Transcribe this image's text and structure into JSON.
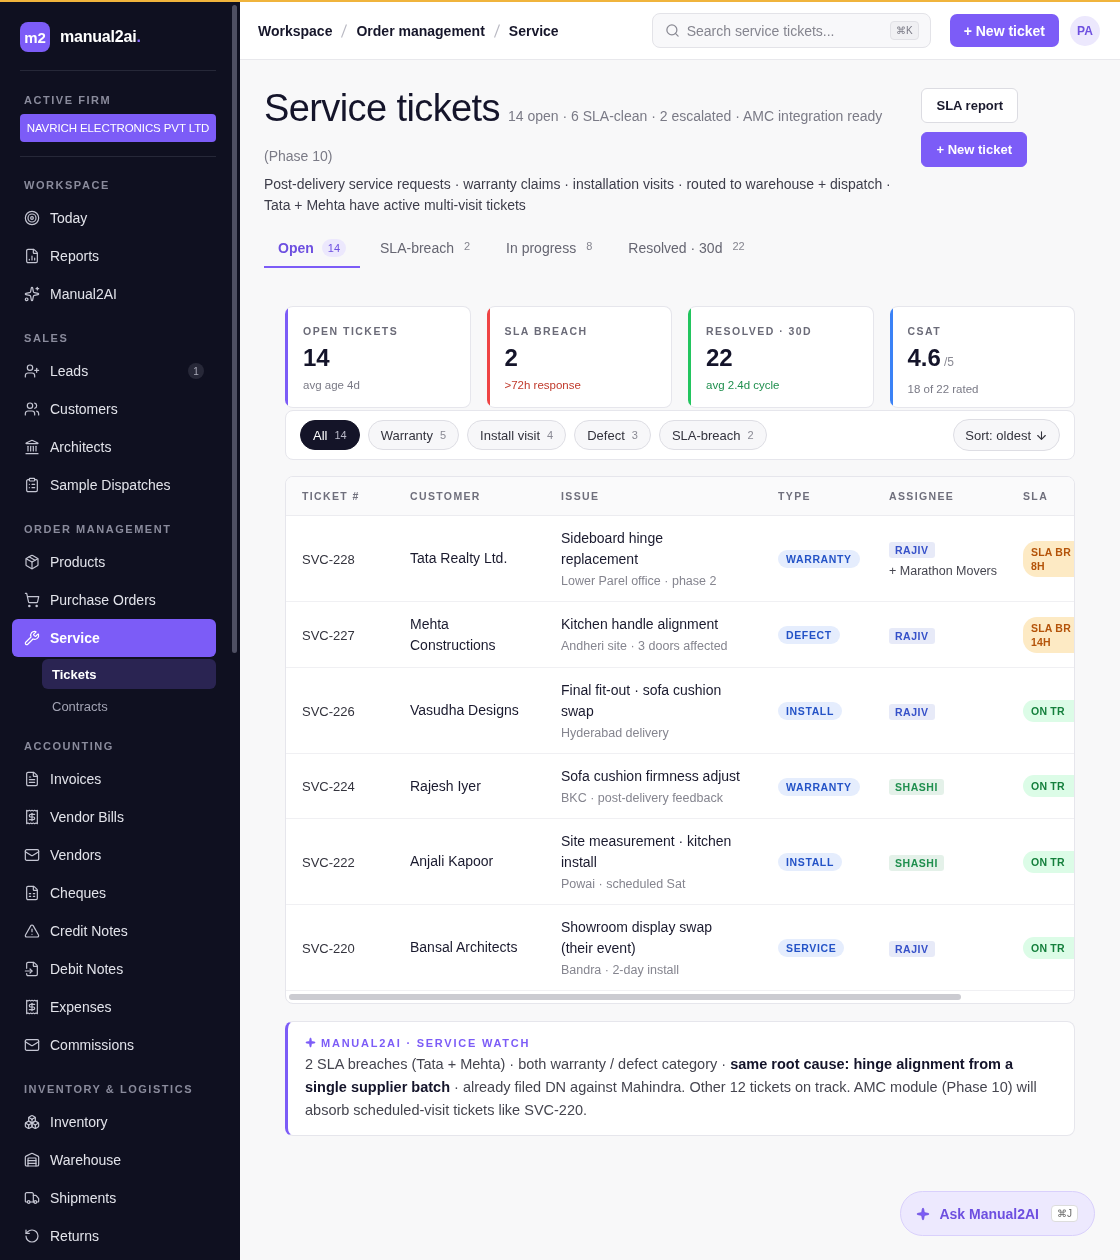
{
  "sidebar": {
    "brand": {
      "logo": "m2",
      "name": "manual2ai",
      "dot": "."
    },
    "active_firm": {
      "label": "ACTIVE FIRM",
      "value": "NAVRICH ELECTRONICS PVT LTD"
    },
    "sections": [
      {
        "title": "WORKSPACE",
        "items": [
          {
            "label": "Today",
            "selected": false
          },
          {
            "label": "Reports",
            "selected": false
          },
          {
            "label": "Manual2AI",
            "selected": false
          }
        ]
      },
      {
        "title": "SALES",
        "items": [
          {
            "label": "Leads",
            "badge": "1",
            "selected": false
          },
          {
            "label": "Customers",
            "selected": false
          },
          {
            "label": "Architects",
            "selected": false
          },
          {
            "label": "Sample Dispatches",
            "selected": false
          }
        ]
      },
      {
        "title": "ORDER MANAGEMENT",
        "items": [
          {
            "label": "Products",
            "selected": false
          },
          {
            "label": "Purchase Orders",
            "selected": false
          },
          {
            "label": "Service",
            "selected": true,
            "children": [
              {
                "label": "Tickets",
                "selected": true
              },
              {
                "label": "Contracts",
                "selected": false
              }
            ]
          }
        ]
      },
      {
        "title": "ACCOUNTING",
        "items": [
          {
            "label": "Invoices",
            "selected": false
          },
          {
            "label": "Vendor Bills",
            "selected": false
          },
          {
            "label": "Vendors",
            "selected": false
          },
          {
            "label": "Cheques",
            "selected": false
          },
          {
            "label": "Credit Notes",
            "selected": false
          },
          {
            "label": "Debit Notes",
            "selected": false
          },
          {
            "label": "Expenses",
            "selected": false
          },
          {
            "label": "Commissions",
            "selected": false
          }
        ]
      },
      {
        "title": "INVENTORY & LOGISTICS",
        "items": [
          {
            "label": "Inventory",
            "selected": false
          },
          {
            "label": "Warehouse",
            "selected": false
          },
          {
            "label": "Shipments",
            "selected": false
          },
          {
            "label": "Returns",
            "selected": false
          }
        ]
      }
    ]
  },
  "header": {
    "breadcrumbs": [
      "Workspace",
      "Order management",
      "Service"
    ],
    "search": {
      "placeholder": "Search service tickets...",
      "shortcut": "⌘K"
    },
    "new_button": "+ New ticket",
    "avatar": "PA"
  },
  "page": {
    "title": "Service tickets",
    "subtitle": "14 open · 6 SLA-clean · 2 escalated · AMC integration ready (Phase 10)",
    "description": "Post-delivery service requests · warranty claims · installation visits · routed to warehouse + dispatch · Tata + Mehta have active multi-visit tickets",
    "actions": [
      {
        "label": "SLA report",
        "kind": "secondary"
      },
      {
        "label": "+ New ticket",
        "kind": "primary"
      }
    ]
  },
  "tabs": [
    {
      "label": "Open",
      "count": "14",
      "selected": true
    },
    {
      "label": "SLA-breach",
      "count": "2",
      "selected": false
    },
    {
      "label": "In progress",
      "count": "8",
      "selected": false
    },
    {
      "label": "Resolved · 30d",
      "count": "22",
      "selected": false
    }
  ],
  "stats": [
    {
      "label": "OPEN TICKETS",
      "value": "14",
      "note": {
        "text": "avg age 4d",
        "color": "#7a7a86"
      },
      "color": "#7c5cf7"
    },
    {
      "label": "SLA BREACH",
      "value": "2",
      "note": {
        "text": ">72h response",
        "color": "#c0392b"
      },
      "color": "#ef4444"
    },
    {
      "label": "RESOLVED · 30D",
      "value": "22",
      "note": {
        "text": "avg 2.4d cycle",
        "color": "#1f8f4e"
      },
      "color": "#22c55e"
    },
    {
      "label": "CSAT",
      "value": "4.6",
      "unit": "/5",
      "note": {
        "text": "18 of 22 rated",
        "color": "#7a7a86"
      },
      "color": "#3b82f6"
    }
  ],
  "filters": {
    "chips": [
      {
        "label": "All",
        "count": "14",
        "selected": true
      },
      {
        "label": "Warranty",
        "count": "5",
        "selected": false
      },
      {
        "label": "Install visit",
        "count": "4",
        "selected": false
      },
      {
        "label": "Defect",
        "count": "3",
        "selected": false
      },
      {
        "label": "SLA-breach",
        "count": "2",
        "selected": false
      }
    ],
    "sort": "Sort: oldest"
  },
  "table": {
    "columns": [
      "TICKET #",
      "CUSTOMER",
      "ISSUE",
      "TYPE",
      "ASSIGNEE",
      "SLA"
    ],
    "rows": [
      {
        "ticket": "SVC-228",
        "customer": "Tata Realty Ltd.",
        "issue": "Sideboard hinge replacement",
        "issue_note": "Lower Parel office · phase 2",
        "type": "WARRANTY",
        "assignee": {
          "name": "RAJIV",
          "color": "#3651c9"
        },
        "assignee_note": "+ Marathon Movers",
        "sla": {
          "text": "SLA BR 8H",
          "kind": "breach"
        }
      },
      {
        "ticket": "SVC-227",
        "customer": "Mehta Constructions",
        "issue": "Kitchen handle alignment",
        "issue_note": "Andheri site · 3 doors affected",
        "type": "DEFECT",
        "assignee": {
          "name": "RAJIV",
          "color": "#3651c9"
        },
        "sla": {
          "text": "SLA BR 14H",
          "kind": "breach"
        }
      },
      {
        "ticket": "SVC-226",
        "customer": "Vasudha Designs",
        "issue": "Final fit-out · sofa cushion swap",
        "issue_note": "Hyderabad delivery",
        "type": "INSTALL",
        "assignee": {
          "name": "RAJIV",
          "color": "#3651c9"
        },
        "sla": {
          "text": "ON TR",
          "kind": "on_track"
        }
      },
      {
        "ticket": "SVC-224",
        "customer": "Rajesh Iyer",
        "issue": "Sofa cushion firmness adjust",
        "issue_note": "BKC · post-delivery feedback",
        "type": "WARRANTY",
        "assignee": {
          "name": "SHASHI",
          "color": "#1f8f4e"
        },
        "sla": {
          "text": "ON TR",
          "kind": "on_track"
        }
      },
      {
        "ticket": "SVC-222",
        "customer": "Anjali Kapoor",
        "issue": "Site measurement · kitchen install",
        "issue_note": "Powai · scheduled Sat",
        "type": "INSTALL",
        "assignee": {
          "name": "SHASHI",
          "color": "#1f8f4e"
        },
        "sla": {
          "text": "ON TR",
          "kind": "on_track"
        }
      },
      {
        "ticket": "SVC-220",
        "customer": "Bansal Architects",
        "issue": "Showroom display swap (their event)",
        "issue_note": "Bandra · 2-day install",
        "type": "SERVICE",
        "assignee": {
          "name": "RAJIV",
          "color": "#3651c9"
        },
        "sla": {
          "text": "ON TR",
          "kind": "on_track"
        }
      }
    ]
  },
  "ai_watch": {
    "title": "MANUAL2AI · SERVICE WATCH",
    "body": "2 SLA breaches (Tata + Mehta) · both warranty / defect category · **same root cause: hinge alignment from a single supplier batch** · already filed DN against Mahindra. Other 12 tickets on track. AMC module (Phase 10) will absorb scheduled-visit tickets like SVC-220."
  },
  "ask_button": {
    "label": "Ask Manual2AI",
    "shortcut": "⌘J"
  }
}
